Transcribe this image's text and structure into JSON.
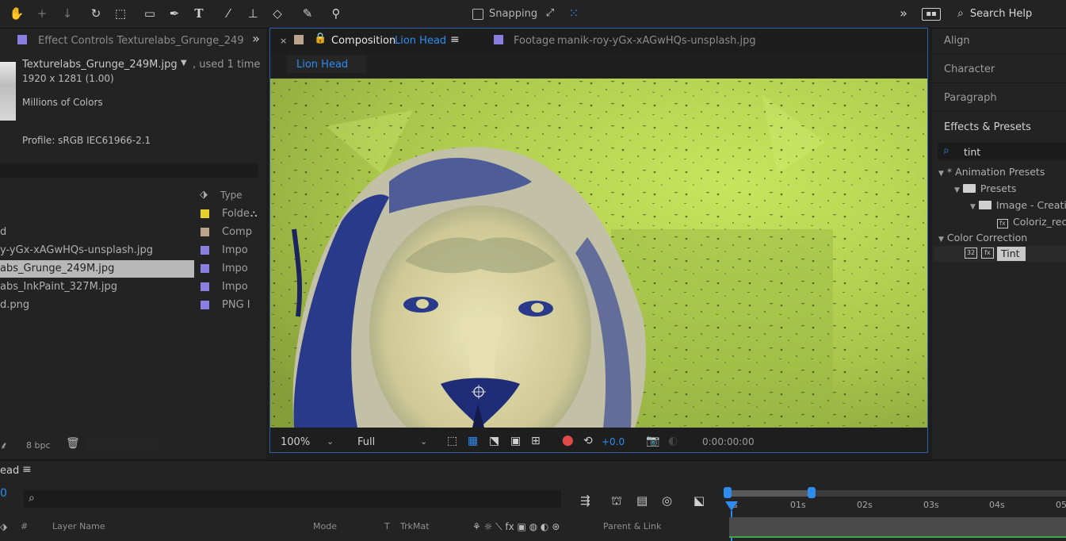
{
  "toolbar": {
    "snapping_label": "Snapping",
    "search_help": "Search Help"
  },
  "left_panel": {
    "tab_label": "Effect Controls Texturelabs_Grunge_249",
    "file_name": "Texturelabs_Grunge_249M.jpg",
    "used_text": ", used 1 time",
    "dimensions": "1920 x 1281 (1.00)",
    "colors": "Millions of Colors",
    "profile": "Profile: sRGB IEC61966-2.1",
    "type_header": "Type",
    "rows": [
      {
        "name": "",
        "type": "Folde",
        "swatch": "#e8d02a"
      },
      {
        "name": "d",
        "type": "Comp",
        "swatch": "#bca38b"
      },
      {
        "name": "y-yGx-xAGwHQs-unsplash.jpg",
        "type": "Impo",
        "swatch": "#8a7ee0"
      },
      {
        "name": "abs_Grunge_249M.jpg",
        "type": "Impo",
        "swatch": "#8a7ee0"
      },
      {
        "name": "abs_InkPaint_327M.jpg",
        "type": "Impo",
        "swatch": "#8a7ee0"
      },
      {
        "name": "d.png",
        "type": "PNG I",
        "swatch": "#8a7ee0"
      }
    ],
    "bpc": "8 bpc"
  },
  "comp_panel": {
    "close": "×",
    "tab_prefix": "Composition",
    "tab_name": "Lion Head",
    "footage_prefix": "Footage",
    "footage_name": "manik-roy-yGx-xAGwHQs-unsplash.jpg",
    "breadcrumb": "Lion Head",
    "zoom": "100%",
    "resolution": "Full",
    "exposure": "+0.0",
    "timecode": "0:00:00:00"
  },
  "right_panel": {
    "items": [
      "Align",
      "Character",
      "Paragraph",
      "Effects & Presets"
    ],
    "search_value": "tint",
    "tree": {
      "animation_presets": "* Animation Presets",
      "presets": "Presets",
      "image_creative": "Image - Creati",
      "colorize": "Coloriz_rec",
      "color_correction": "Color Correction",
      "tint": "Tint"
    }
  },
  "timeline": {
    "comp_name": "ead",
    "time_digit": "0",
    "ruler": [
      "0s",
      "01s",
      "02s",
      "03s",
      "04s",
      "05"
    ],
    "columns": {
      "hash": "#",
      "layer_name": "Layer Name",
      "mode": "Mode",
      "t": "T",
      "trkmat": "TrkMat",
      "parent": "Parent & Link"
    }
  },
  "colors": {
    "accent_blue": "#2d8cf0",
    "selection_border": "#2d5fa8",
    "tint_green": "#c6e25a",
    "lion_blue": "#2a3a8a"
  }
}
